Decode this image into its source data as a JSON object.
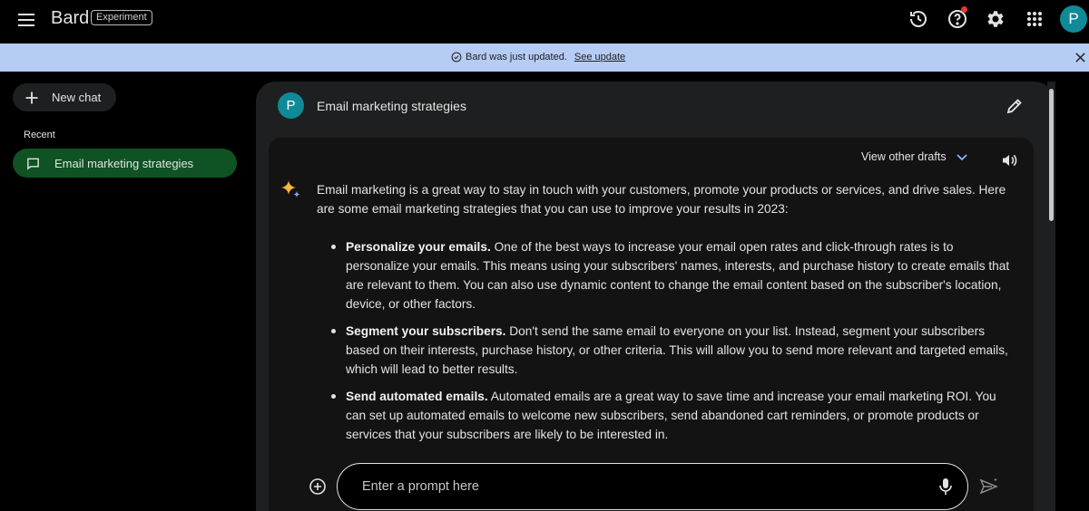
{
  "app": {
    "name": "Bard",
    "badge": "Experiment",
    "user_initial": "P"
  },
  "banner": {
    "text": "Bard was just updated.",
    "link": "See update"
  },
  "sidebar": {
    "new_chat_label": "New chat",
    "recent_label": "Recent",
    "items": [
      {
        "label": "Email marketing strategies",
        "active": true
      }
    ]
  },
  "conversation": {
    "user_initial": "P",
    "query": "Email marketing strategies",
    "drafts_label": "View other drafts",
    "intro": "Email marketing is a great way to stay in touch with your customers, promote your products or services, and drive sales. Here are some email marketing strategies that you can use to improve your results in 2023:",
    "points": [
      {
        "title": "Personalize your emails.",
        "body": "One of the best ways to increase your email open rates and click-through rates is to personalize your emails. This means using your subscribers' names, interests, and purchase history to create emails that are relevant to them. You can also use dynamic content to change the email content based on the subscriber's location, device, or other factors."
      },
      {
        "title": "Segment your subscribers.",
        "body": "Don't send the same email to everyone on your list. Instead, segment your subscribers based on their interests, purchase history, or other criteria. This will allow you to send more relevant and targeted emails, which will lead to better results."
      },
      {
        "title": "Send automated emails.",
        "body": "Automated emails are a great way to save time and increase your email marketing ROI. You can set up automated emails to welcome new subscribers, send abandoned cart reminders, or promote products or services that your subscribers are likely to be interested in."
      }
    ]
  },
  "prompt": {
    "placeholder": "Enter a prompt here"
  },
  "colors": {
    "accent_avatar": "#0f8a96",
    "active_item": "#0f5223",
    "banner": "#b5ccf4",
    "sparkle": "#f5b63a"
  },
  "icons": [
    "menu-icon",
    "history-icon",
    "help-icon",
    "gear-icon",
    "apps-grid-icon",
    "check-circle-icon",
    "close-icon",
    "plus-icon",
    "chat-bubble-icon",
    "pencil-icon",
    "chevron-down-icon",
    "speaker-icon",
    "sparkle-icon",
    "add-circle-icon",
    "mic-icon",
    "send-icon"
  ]
}
